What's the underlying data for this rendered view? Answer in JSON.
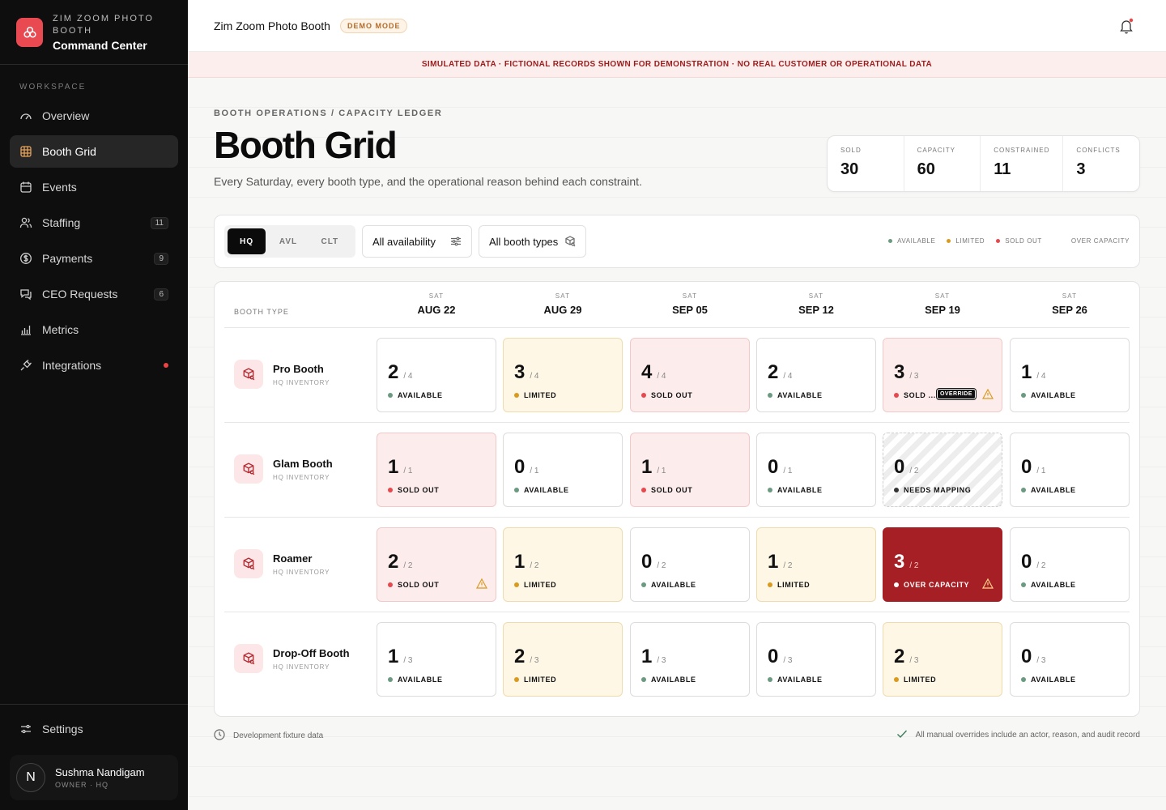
{
  "brand": {
    "top": "ZIM ZOOM PHOTO BOOTH",
    "name": "Command Center"
  },
  "sidebar": {
    "section_label": "WORKSPACE",
    "items": [
      {
        "label": "Overview",
        "icon": "gauge-icon"
      },
      {
        "label": "Booth Grid",
        "icon": "grid-icon",
        "active": true
      },
      {
        "label": "Events",
        "icon": "calendar-icon"
      },
      {
        "label": "Staffing",
        "icon": "users-icon",
        "badge": "11"
      },
      {
        "label": "Payments",
        "icon": "dollar-icon",
        "badge": "9"
      },
      {
        "label": "CEO Requests",
        "icon": "chat-icon",
        "badge": "6"
      },
      {
        "label": "Metrics",
        "icon": "bar-chart-icon"
      },
      {
        "label": "Integrations",
        "icon": "plug-icon",
        "dot": true
      }
    ],
    "settings_label": "Settings",
    "user": {
      "initial": "N",
      "name": "Sushma Nandigam",
      "role": "OWNER · HQ"
    }
  },
  "topbar": {
    "title": "Zim Zoom Photo Booth",
    "badge": "DEMO MODE"
  },
  "banner": "SIMULATED DATA · FICTIONAL RECORDS SHOWN FOR DEMONSTRATION · NO REAL CUSTOMER OR OPERATIONAL DATA",
  "header": {
    "breadcrumb": "BOOTH OPERATIONS / CAPACITY LEDGER",
    "title": "Booth Grid",
    "subtitle": "Every Saturday, every booth type, and the operational reason behind each constraint."
  },
  "kpis": [
    {
      "label": "SOLD",
      "value": "30"
    },
    {
      "label": "CAPACITY",
      "value": "60"
    },
    {
      "label": "CONSTRAINED",
      "value": "11"
    },
    {
      "label": "CONFLICTS",
      "value": "3"
    }
  ],
  "filters": {
    "locations": [
      "HQ",
      "AVL",
      "CLT"
    ],
    "active_location": "HQ",
    "availability": "All availability",
    "booth_types": "All booth types"
  },
  "legend": [
    {
      "label": "AVAILABLE",
      "color": "#6a9a80"
    },
    {
      "label": "LIMITED",
      "color": "#d99a1e"
    },
    {
      "label": "SOLD OUT",
      "color": "#e5484d"
    },
    {
      "label": "OVER CAPACITY",
      "color": ""
    }
  ],
  "grid": {
    "col_header": "BOOTH TYPE",
    "dates": [
      {
        "day": "SAT",
        "date": "AUG 22"
      },
      {
        "day": "SAT",
        "date": "AUG 29"
      },
      {
        "day": "SAT",
        "date": "SEP 05"
      },
      {
        "day": "SAT",
        "date": "SEP 12"
      },
      {
        "day": "SAT",
        "date": "SEP 19"
      },
      {
        "day": "SAT",
        "date": "SEP 26"
      }
    ],
    "rows": [
      {
        "name": "Pro Booth",
        "sub": "HQ INVENTORY",
        "cells": [
          {
            "sold": "2",
            "cap": "/ 4",
            "status": "AVAILABLE",
            "kind": "available"
          },
          {
            "sold": "3",
            "cap": "/ 4",
            "status": "LIMITED",
            "kind": "limited"
          },
          {
            "sold": "4",
            "cap": "/ 4",
            "status": "SOLD OUT",
            "kind": "soldout"
          },
          {
            "sold": "2",
            "cap": "/ 4",
            "status": "AVAILABLE",
            "kind": "available"
          },
          {
            "sold": "3",
            "cap": "/ 3",
            "status": "SOLD ...",
            "kind": "soldout",
            "override": "OVERRIDE",
            "warn": true
          },
          {
            "sold": "1",
            "cap": "/ 4",
            "status": "AVAILABLE",
            "kind": "available"
          }
        ]
      },
      {
        "name": "Glam Booth",
        "sub": "HQ INVENTORY",
        "cells": [
          {
            "sold": "1",
            "cap": "/ 1",
            "status": "SOLD OUT",
            "kind": "soldout"
          },
          {
            "sold": "0",
            "cap": "/ 1",
            "status": "AVAILABLE",
            "kind": "available"
          },
          {
            "sold": "1",
            "cap": "/ 1",
            "status": "SOLD OUT",
            "kind": "soldout"
          },
          {
            "sold": "0",
            "cap": "/ 1",
            "status": "AVAILABLE",
            "kind": "available"
          },
          {
            "sold": "0",
            "cap": "/ 2",
            "status": "NEEDS MAPPING",
            "kind": "needs"
          },
          {
            "sold": "0",
            "cap": "/ 1",
            "status": "AVAILABLE",
            "kind": "available"
          }
        ]
      },
      {
        "name": "Roamer",
        "sub": "HQ INVENTORY",
        "cells": [
          {
            "sold": "2",
            "cap": "/ 2",
            "status": "SOLD OUT",
            "kind": "soldout",
            "warn": true
          },
          {
            "sold": "1",
            "cap": "/ 2",
            "status": "LIMITED",
            "kind": "limited"
          },
          {
            "sold": "0",
            "cap": "/ 2",
            "status": "AVAILABLE",
            "kind": "available"
          },
          {
            "sold": "1",
            "cap": "/ 2",
            "status": "LIMITED",
            "kind": "limited"
          },
          {
            "sold": "3",
            "cap": "/ 2",
            "status": "OVER CAPACITY",
            "kind": "over",
            "warn": true
          },
          {
            "sold": "0",
            "cap": "/ 2",
            "status": "AVAILABLE",
            "kind": "available"
          }
        ]
      },
      {
        "name": "Drop-Off Booth",
        "sub": "HQ INVENTORY",
        "cells": [
          {
            "sold": "1",
            "cap": "/ 3",
            "status": "AVAILABLE",
            "kind": "available"
          },
          {
            "sold": "2",
            "cap": "/ 3",
            "status": "LIMITED",
            "kind": "limited"
          },
          {
            "sold": "1",
            "cap": "/ 3",
            "status": "AVAILABLE",
            "kind": "available"
          },
          {
            "sold": "0",
            "cap": "/ 3",
            "status": "AVAILABLE",
            "kind": "available"
          },
          {
            "sold": "2",
            "cap": "/ 3",
            "status": "LIMITED",
            "kind": "limited"
          },
          {
            "sold": "0",
            "cap": "/ 3",
            "status": "AVAILABLE",
            "kind": "available"
          }
        ]
      }
    ]
  },
  "footer": {
    "left": "Development fixture data",
    "right": "All manual overrides include an actor, reason, and audit record"
  },
  "colors": {
    "accent": "#e94a52",
    "available": "#6a9a80",
    "limited": "#d99a1e",
    "soldout": "#e5484d",
    "over": "#a61f24"
  }
}
